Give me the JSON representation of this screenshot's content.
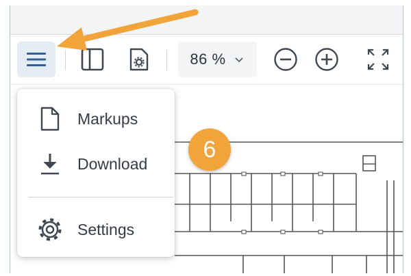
{
  "toolbar": {
    "zoom_level": "86 %",
    "buttons": [
      {
        "name": "menu",
        "icon": "hamburger-icon"
      },
      {
        "name": "panel",
        "icon": "panel-icon"
      },
      {
        "name": "document-settings",
        "icon": "document-gear-icon"
      },
      {
        "name": "zoom-out",
        "icon": "minus-circle-icon"
      },
      {
        "name": "zoom-in",
        "icon": "plus-circle-icon"
      },
      {
        "name": "fullscreen",
        "icon": "expand-icon"
      }
    ]
  },
  "menu": {
    "items": [
      {
        "label": "Markups",
        "icon": "document-icon"
      },
      {
        "label": "Download",
        "icon": "download-icon"
      },
      {
        "label": "Settings",
        "icon": "gear-icon"
      }
    ]
  },
  "annotation": {
    "step_number": "6",
    "arrow_color": "#f0a43a",
    "badge_color": "#f0a43a"
  },
  "colors": {
    "accent": "#2e5f97",
    "toolbar_active_bg": "#e6ecf3"
  }
}
